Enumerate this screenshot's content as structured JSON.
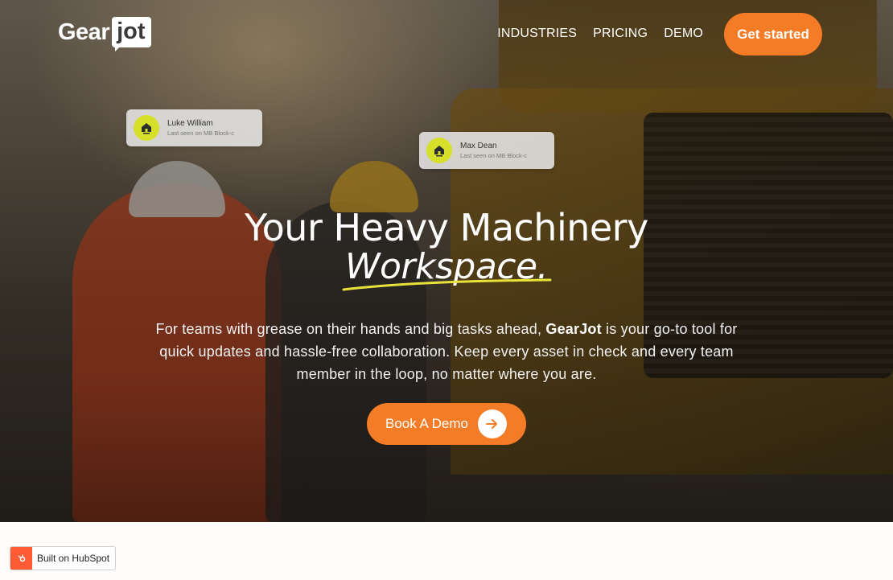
{
  "brand": {
    "logo_part1": "Gear",
    "logo_part2": "jot"
  },
  "nav": {
    "items": [
      "INDUSTRIES",
      "PRICING",
      "DEMO"
    ],
    "cta_label": "Get started"
  },
  "cards": [
    {
      "name": "Luke William",
      "status": "Last seen on MB Block-c",
      "icon": "home-icon"
    },
    {
      "name": "Max Dean",
      "status": "Last seen on MB Block-c",
      "icon": "home-icon"
    }
  ],
  "hero": {
    "title_line1": "Your Heavy Machinery",
    "title_line2": "Workspace.",
    "description_before": "For teams with grease on their hands and big tasks ahead, ",
    "description_bold": "GearJot",
    "description_after": " is your go-to tool for quick updates and hassle-free collaboration. Keep every asset in check and every team member in the loop, no matter where you are.",
    "demo_button_label": "Book A Demo"
  },
  "hubspot_badge": "Built on HubSpot",
  "colors": {
    "accent": "#f47c26",
    "card_avatar": "#d6e02a",
    "underline": "#e8e33a",
    "hubspot": "#ff5c35"
  }
}
